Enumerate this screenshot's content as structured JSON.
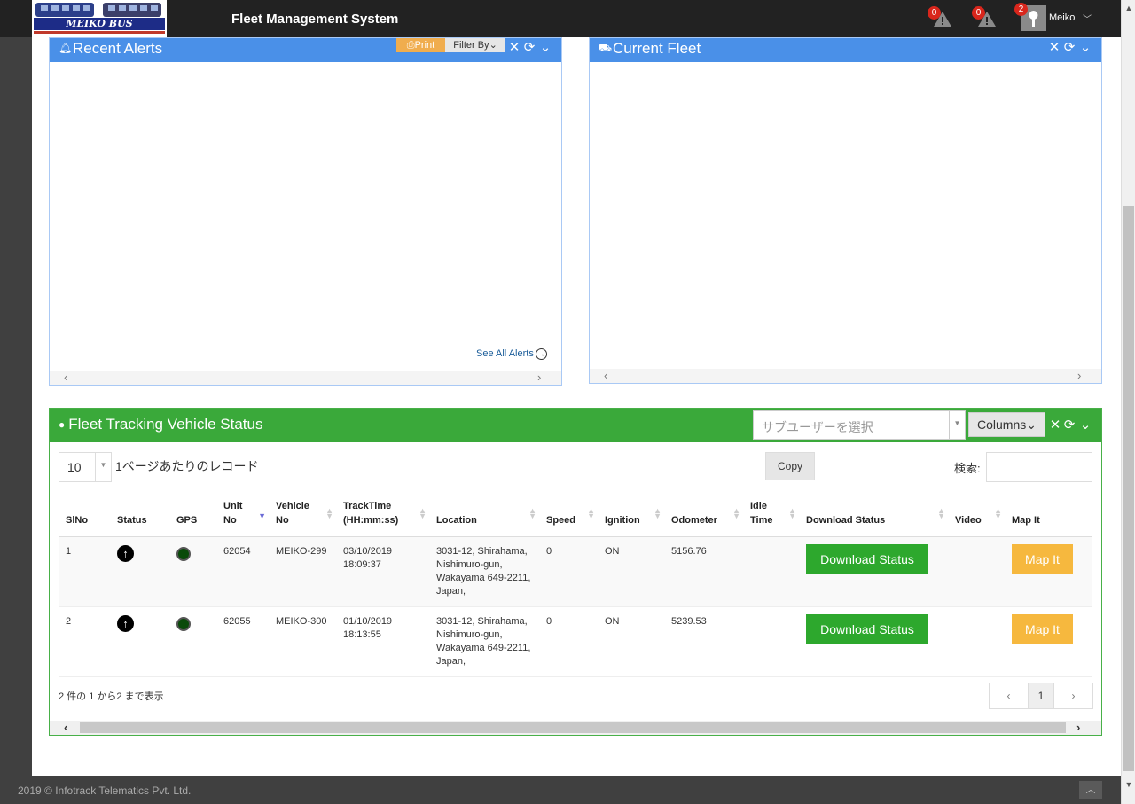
{
  "app": {
    "logo_text": "MEIKO BUS",
    "title": "Fleet Management System"
  },
  "topbar": {
    "alerts": [
      {
        "icon": "warning-icon",
        "count": "0"
      },
      {
        "icon": "warning-icon",
        "count": "0"
      },
      {
        "icon": "user-icon",
        "count": "2"
      }
    ],
    "user_name": "Meiko"
  },
  "recent_alerts": {
    "title": "Recent Alerts",
    "print_label": "Print",
    "filter_label": "Filter By",
    "see_all": "See All Alerts"
  },
  "current_fleet": {
    "title": "Current Fleet"
  },
  "tracking": {
    "title": "Fleet Tracking Vehicle Status",
    "subuser_placeholder": "サブユーザーを選択",
    "columns_label": "Columns",
    "page_length": "10",
    "page_length_label": "1ページあたりのレコード",
    "copy_label": "Copy",
    "search_label": "検索:",
    "columns": [
      "SlNo",
      "Status",
      "GPS",
      "Unit No",
      "Vehicle No",
      "TrackTime (HH:mm:ss)",
      "Location",
      "Speed",
      "Ignition",
      "Odometer",
      "Idle Time",
      "Download Status",
      "Video",
      "Map It"
    ],
    "rows": [
      {
        "slno": "1",
        "unit_no": "62054",
        "vehicle_no": "MEIKO-299",
        "track_date": "03/10/2019",
        "track_time": "18:09:37",
        "location": "3031-12, Shirahama, Nishimuro-gun, Wakayama 649-2211, Japan,",
        "speed": "0",
        "ignition": "ON",
        "odometer": "5156.76",
        "idle_time": "",
        "download_label": "Download Status",
        "video": "",
        "map_label": "Map It"
      },
      {
        "slno": "2",
        "unit_no": "62055",
        "vehicle_no": "MEIKO-300",
        "track_date": "01/10/2019",
        "track_time": "18:13:55",
        "location": "3031-12, Shirahama, Nishimuro-gun, Wakayama 649-2211, Japan,",
        "speed": "0",
        "ignition": "ON",
        "odometer": "5239.53",
        "idle_time": "",
        "download_label": "Download Status",
        "video": "",
        "map_label": "Map It"
      }
    ],
    "info": "2 件の 1 から2 まで表示",
    "pager": {
      "prev": "‹",
      "current": "1",
      "next": "›"
    }
  },
  "footer": {
    "copyright": "2019 © Infotrack Telematics Pvt. Ltd."
  },
  "colors": {
    "topbar": "#222222",
    "blue_panel": "#4a90e8",
    "green_panel": "#3aa93a",
    "print": "#f0ad4e",
    "download": "#2da82d",
    "map": "#f6b83e",
    "badge": "#d9261c"
  }
}
